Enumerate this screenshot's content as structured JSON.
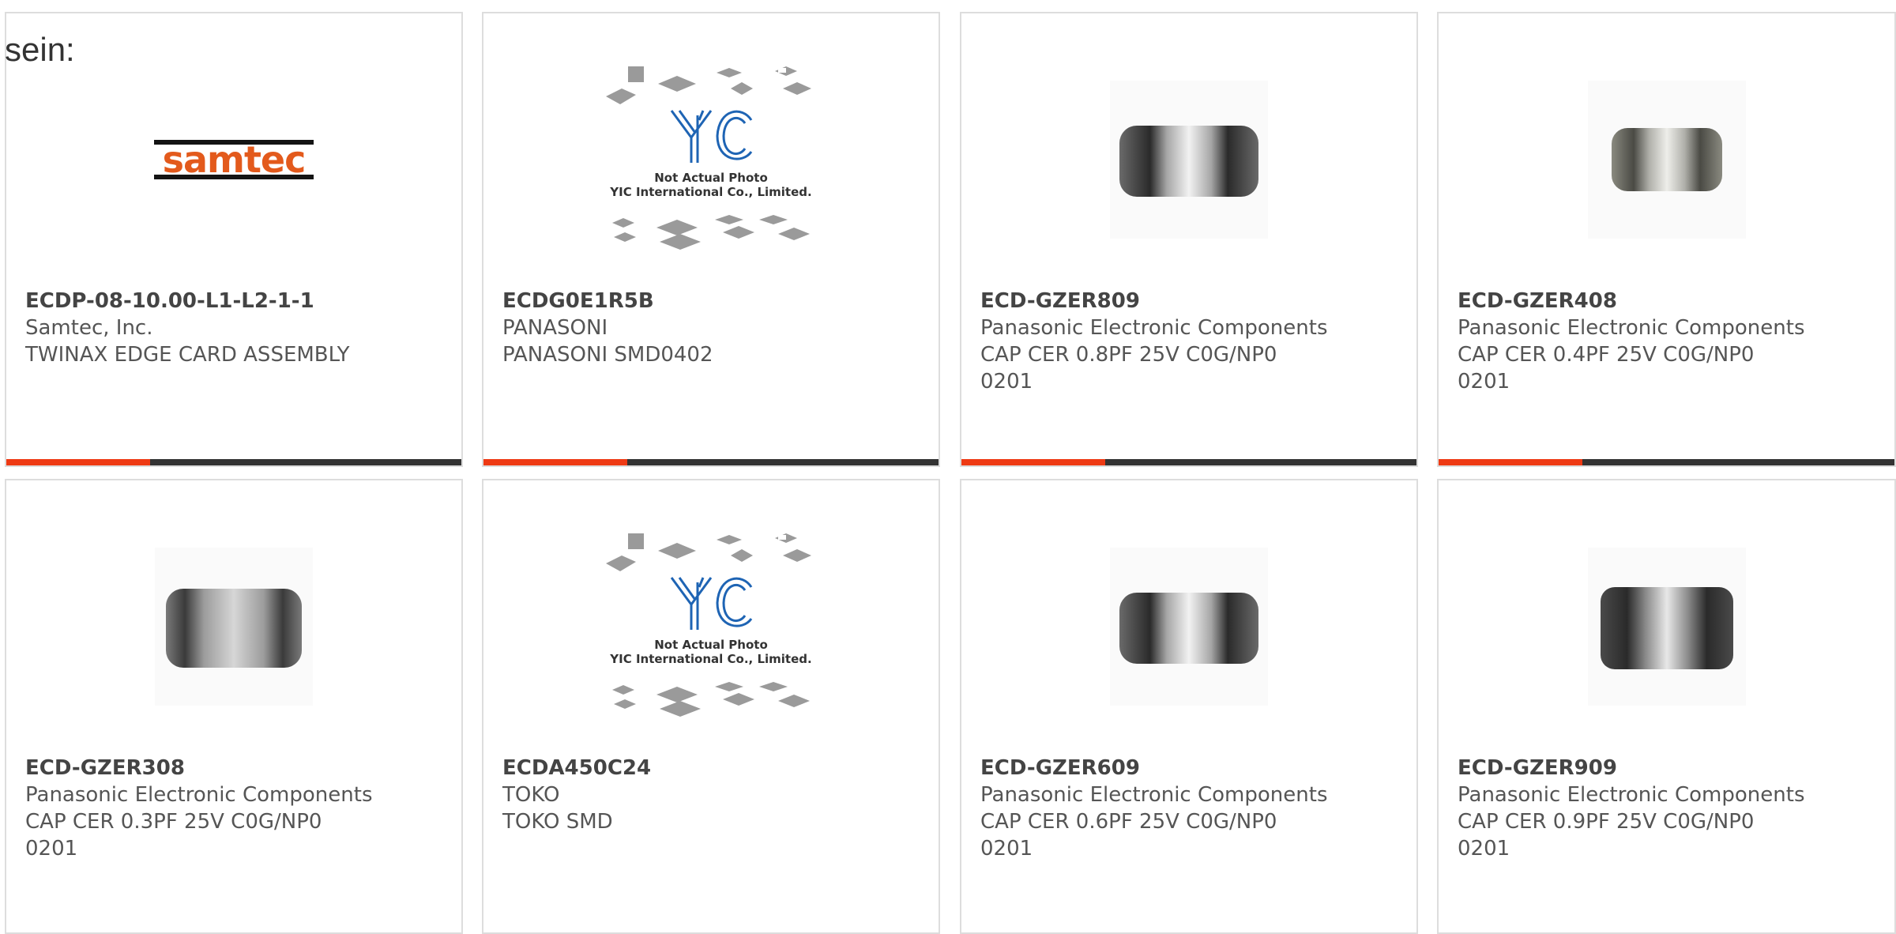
{
  "intro_text": "sein:",
  "colors": {
    "accent": "#ee3a14",
    "bar_track": "#333333",
    "border": "#dddddd"
  },
  "products": [
    {
      "part_number": "ECDP-08-10.00-L1-L2-1-1",
      "manufacturer": "Samtec, Inc.",
      "desc1": "TWINAX EDGE CARD ASSEMBLY",
      "desc2": "",
      "image": "samtec-logo",
      "logo_text": "samtec"
    },
    {
      "part_number": "ECDG0E1R5B",
      "manufacturer": "PANASONI",
      "desc1": "PANASONI SMD0402",
      "desc2": "",
      "image": "yic-placeholder",
      "yic_note1": "Not Actual Photo",
      "yic_note2": "YIC International Co., Limited."
    },
    {
      "part_number": "ECD-GZER809",
      "manufacturer": "Panasonic Electronic Components",
      "desc1": "CAP CER 0.8PF 25V C0G/NP0",
      "desc2": "0201",
      "image": "chip-capacitor"
    },
    {
      "part_number": "ECD-GZER408",
      "manufacturer": "Panasonic Electronic Components",
      "desc1": "CAP CER 0.4PF 25V C0G/NP0",
      "desc2": "0201",
      "image": "chip-capacitor"
    },
    {
      "part_number": "ECD-GZER308",
      "manufacturer": "Panasonic Electronic Components",
      "desc1": "CAP CER 0.3PF 25V C0G/NP0",
      "desc2": "0201",
      "image": "chip-capacitor"
    },
    {
      "part_number": "ECDA450C24",
      "manufacturer": "TOKO",
      "desc1": "TOKO SMD",
      "desc2": "",
      "image": "yic-placeholder",
      "yic_note1": "Not Actual Photo",
      "yic_note2": "YIC International Co., Limited."
    },
    {
      "part_number": "ECD-GZER609",
      "manufacturer": "Panasonic Electronic Components",
      "desc1": "CAP CER 0.6PF 25V C0G/NP0",
      "desc2": "0201",
      "image": "chip-capacitor"
    },
    {
      "part_number": "ECD-GZER909",
      "manufacturer": "Panasonic Electronic Components",
      "desc1": "CAP CER 0.9PF 25V C0G/NP0",
      "desc2": "0201",
      "image": "chip-capacitor"
    }
  ]
}
